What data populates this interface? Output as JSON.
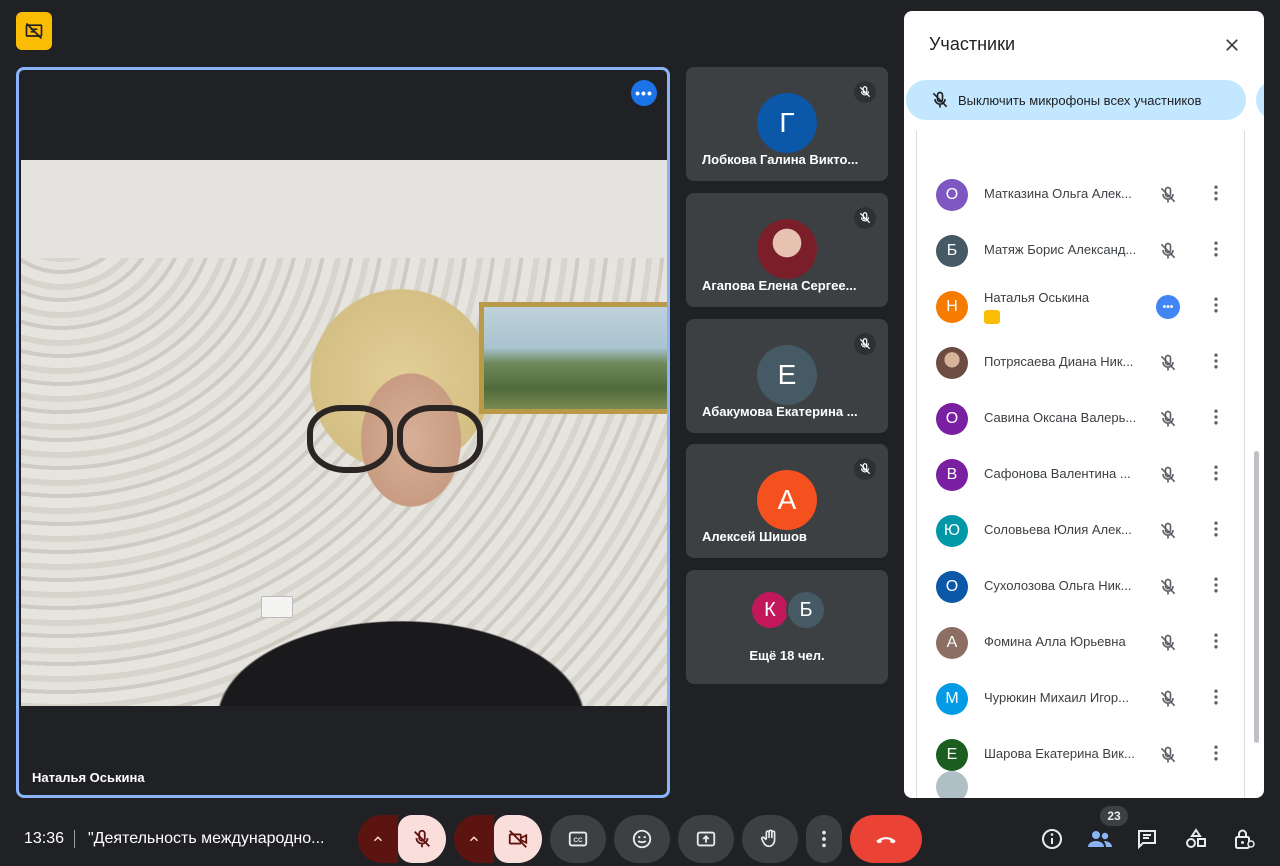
{
  "main_tile": {
    "name": "Наталья Оськина",
    "more_icon": "more-horiz-icon"
  },
  "side_tiles": [
    {
      "name": "Лобкова Галина Викто...",
      "initial": "Г",
      "color": "#0b57a8"
    },
    {
      "name": "Агапова Елена Сергее...",
      "initial": "",
      "color": "#5a2c32"
    },
    {
      "name": "Абакумова Екатерина ...",
      "initial": "Е",
      "color": "#455a64"
    },
    {
      "name": "Алексей Шишов",
      "initial": "А",
      "color": "#f4511e"
    }
  ],
  "more_tile": {
    "label": "Ещё 18 чел.",
    "initials": [
      "К",
      "Б"
    ],
    "colors": [
      "#c2185b",
      "#455a64"
    ]
  },
  "panel": {
    "title": "Участники",
    "mute_all_label": "Выключить микрофоны всех участников",
    "participants": [
      {
        "initial": "О",
        "name": "Матказина Ольга Алек...",
        "color": "#7e57c2",
        "status": "muted"
      },
      {
        "initial": "Б",
        "name": "Матяж Борис Александ...",
        "color": "#455a64",
        "status": "muted"
      },
      {
        "initial": "Н",
        "name": "Наталья Оськина",
        "color": "#f57c00",
        "status": "more"
      },
      {
        "initial": "",
        "name": "Потрясаева Диана Ник...",
        "color": "#6d4c41",
        "status": "muted"
      },
      {
        "initial": "О",
        "name": "Савина Оксана Валерь...",
        "color": "#7b1fa2",
        "status": "muted"
      },
      {
        "initial": "В",
        "name": "Сафонова Валентина ...",
        "color": "#7b1fa2",
        "status": "muted"
      },
      {
        "initial": "Ю",
        "name": "Соловьева Юлия Алек...",
        "color": "#0097a7",
        "status": "muted"
      },
      {
        "initial": "О",
        "name": "Сухолозова Ольга Ник...",
        "color": "#0b57a8",
        "status": "muted"
      },
      {
        "initial": "А",
        "name": "Фомина Алла Юрьевна",
        "color": "#8d6e63",
        "status": "muted"
      },
      {
        "initial": "М",
        "name": "Чурюкин Михаил Игор...",
        "color": "#039be5",
        "status": "muted"
      },
      {
        "initial": "Е",
        "name": "Шарова Екатерина Вик...",
        "color": "#1b5e20",
        "status": "muted"
      }
    ]
  },
  "bottom": {
    "time": "13:36",
    "meeting_title": "\"Деятельность международно...",
    "participant_count": "23"
  },
  "colors": {
    "accent": "#8ab4f8",
    "end_call": "#ea4335",
    "mute_all_bg": "#c2e7ff"
  }
}
